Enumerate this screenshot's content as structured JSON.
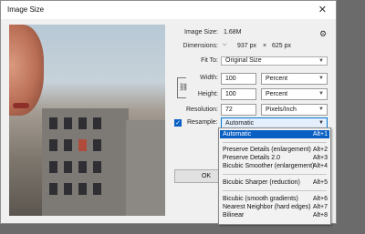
{
  "dialog": {
    "title": "Image Size",
    "close": "✕"
  },
  "image_size": {
    "label": "Image Size:",
    "value": "1.68M"
  },
  "dimensions": {
    "label": "Dimensions:",
    "width": "937 px",
    "times": "×",
    "height": "625 px"
  },
  "fit_to": {
    "label": "Fit To:",
    "value": "Original Size"
  },
  "width": {
    "label": "Width:",
    "value": "100",
    "unit": "Percent"
  },
  "height": {
    "label": "Height:",
    "value": "100",
    "unit": "Percent"
  },
  "resolution": {
    "label": "Resolution:",
    "value": "72",
    "unit": "Pixels/Inch"
  },
  "resample": {
    "label": "Resample:",
    "value": "Automatic",
    "checked": true
  },
  "ok_button": "OK",
  "menu": {
    "items": [
      {
        "label": "Automatic",
        "key": "Alt+1"
      },
      {
        "label": "Preserve Details (enlargement)",
        "key": "Alt+2"
      },
      {
        "label": "Preserve Details 2.0",
        "key": "Alt+3"
      },
      {
        "label": "Bicubic Smoother (enlargement)",
        "key": "Alt+4"
      },
      {
        "label": "Bicubic Sharper (reduction)",
        "key": "Alt+5"
      },
      {
        "label": "Bicubic (smooth gradients)",
        "key": "Alt+6"
      },
      {
        "label": "Nearest Neighbor (hard edges)",
        "key": "Alt+7"
      },
      {
        "label": "Bilinear",
        "key": "Alt+8"
      }
    ]
  },
  "icons": {
    "gear": "gear-icon",
    "link": "link-chain-icon",
    "dropdown": "chevron-down-icon",
    "check": "checkmark-icon"
  },
  "colors": {
    "accent": "#0a5fc4"
  }
}
